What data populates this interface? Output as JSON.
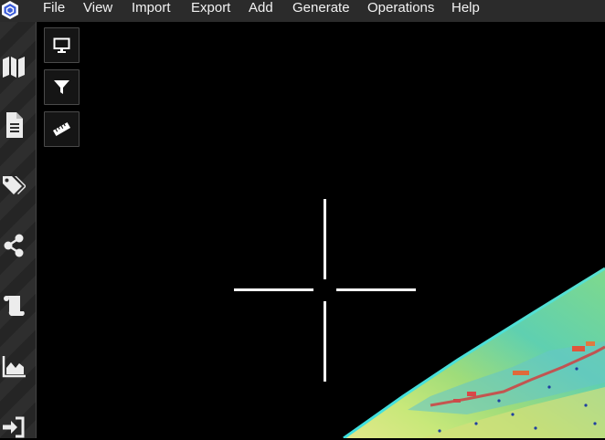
{
  "menu": {
    "items": [
      "File",
      "View",
      "Import",
      "Export",
      "Add",
      "Generate",
      "Operations",
      "Help"
    ]
  },
  "sidebar": {
    "icons": [
      "map-icon",
      "document-icon",
      "tags-icon",
      "share-icon",
      "scroll-icon",
      "area-chart-icon",
      "sign-in-icon"
    ]
  },
  "viewport_tools": [
    "monitor-icon",
    "filter-icon",
    "ruler-icon"
  ],
  "colors": {
    "menu_bg": "#2b2b2b",
    "viewport_bg": "#000000",
    "accent_logo": "#3a5bd8",
    "crosshair": "#ffffff"
  }
}
